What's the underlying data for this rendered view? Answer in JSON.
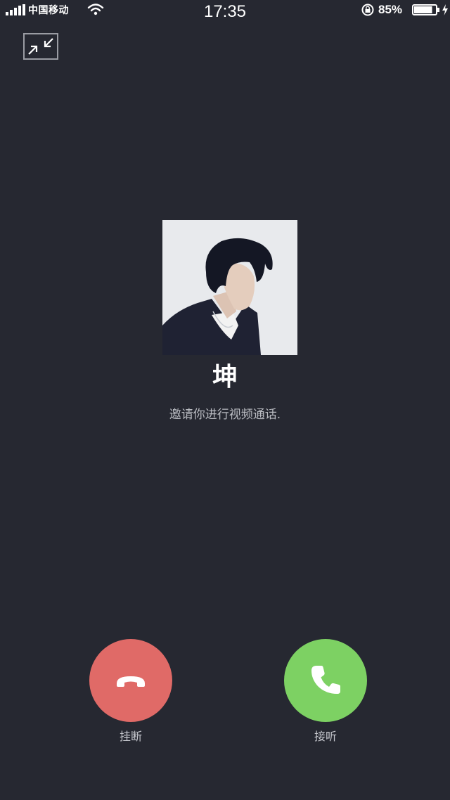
{
  "status_bar": {
    "carrier": "中国移动",
    "time": "17:35",
    "battery_percent": "85%",
    "battery_level": 0.85,
    "icons": [
      "signal-icon",
      "wifi-icon",
      "rotation-lock-icon",
      "battery-icon",
      "charging-icon"
    ]
  },
  "controls": {
    "minimize_icon": "minimize-icon"
  },
  "caller": {
    "name": "坤",
    "status": "邀请你进行视频通话."
  },
  "actions": {
    "hangup": {
      "label": "挂断",
      "color": "#e06a67",
      "icon": "hang-up-phone-icon"
    },
    "answer": {
      "label": "接听",
      "color": "#7dd163",
      "icon": "phone-icon"
    }
  },
  "colors": {
    "background": "#262831",
    "text_primary": "#ffffff",
    "text_secondary": "#b9bbc1"
  }
}
